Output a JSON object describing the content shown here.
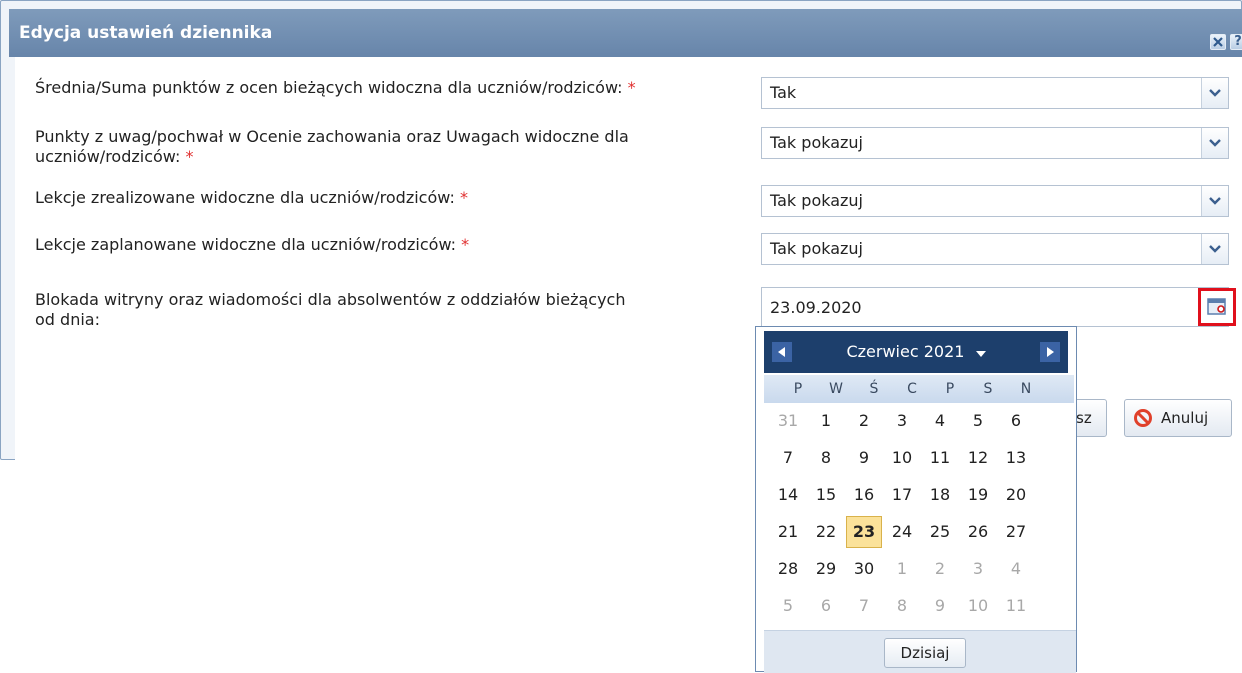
{
  "dialog": {
    "title": "Edycja ustawień dziennika",
    "close_icon": "close-icon",
    "help_glyph": "?"
  },
  "form": {
    "required_mark": "*",
    "rows": [
      {
        "label": "Średnia/Suma punktów z ocen bieżących widoczna dla uczniów/rodziców:",
        "value": "Tak"
      },
      {
        "label_line1": "Punkty z uwag/pochwał w Ocenie zachowania oraz Uwagach widoczne dla",
        "label_line2": "uczniów/rodziców:",
        "value": "Tak pokazuj"
      },
      {
        "label": "Lekcje zrealizowane widoczne dla uczniów/rodziców:",
        "value": "Tak pokazuj"
      },
      {
        "label": "Lekcje zaplanowane widoczne dla uczniów/rodziców:",
        "value": "Tak pokazuj"
      },
      {
        "label_line1": "Blokada witryny oraz wiadomości dla absolwentów z oddziałów bieżących",
        "label_line2": "od dnia:",
        "value": "23.09.2020"
      }
    ]
  },
  "footer": {
    "save_partial": "sz",
    "cancel_label": "Anuluj"
  },
  "calendar": {
    "month_label": "Czerwiec 2021",
    "weekdays": [
      "P",
      "W",
      "Ś",
      "C",
      "P",
      "S",
      "N"
    ],
    "weeks": [
      [
        {
          "d": "31",
          "o": true
        },
        {
          "d": "1"
        },
        {
          "d": "2"
        },
        {
          "d": "3"
        },
        {
          "d": "4"
        },
        {
          "d": "5"
        },
        {
          "d": "6"
        }
      ],
      [
        {
          "d": "7"
        },
        {
          "d": "8"
        },
        {
          "d": "9"
        },
        {
          "d": "10"
        },
        {
          "d": "11"
        },
        {
          "d": "12"
        },
        {
          "d": "13"
        }
      ],
      [
        {
          "d": "14"
        },
        {
          "d": "15"
        },
        {
          "d": "16"
        },
        {
          "d": "17"
        },
        {
          "d": "18"
        },
        {
          "d": "19"
        },
        {
          "d": "20"
        }
      ],
      [
        {
          "d": "21"
        },
        {
          "d": "22"
        },
        {
          "d": "23",
          "sel": true
        },
        {
          "d": "24"
        },
        {
          "d": "25"
        },
        {
          "d": "26"
        },
        {
          "d": "27"
        }
      ],
      [
        {
          "d": "28"
        },
        {
          "d": "29"
        },
        {
          "d": "30"
        },
        {
          "d": "1",
          "o": true
        },
        {
          "d": "2",
          "o": true
        },
        {
          "d": "3",
          "o": true
        },
        {
          "d": "4",
          "o": true
        }
      ],
      [
        {
          "d": "5",
          "o": true
        },
        {
          "d": "6",
          "o": true
        },
        {
          "d": "7",
          "o": true
        },
        {
          "d": "8",
          "o": true
        },
        {
          "d": "9",
          "o": true
        },
        {
          "d": "10",
          "o": true
        },
        {
          "d": "11",
          "o": true
        }
      ]
    ],
    "today_label": "Dzisiaj"
  },
  "colors": {
    "title_bar": "#6f8db3",
    "calendar_header": "#1d3f6c",
    "selected_day": "#fbe29a",
    "highlight_border": "#e0101c",
    "required": "#e03030"
  }
}
